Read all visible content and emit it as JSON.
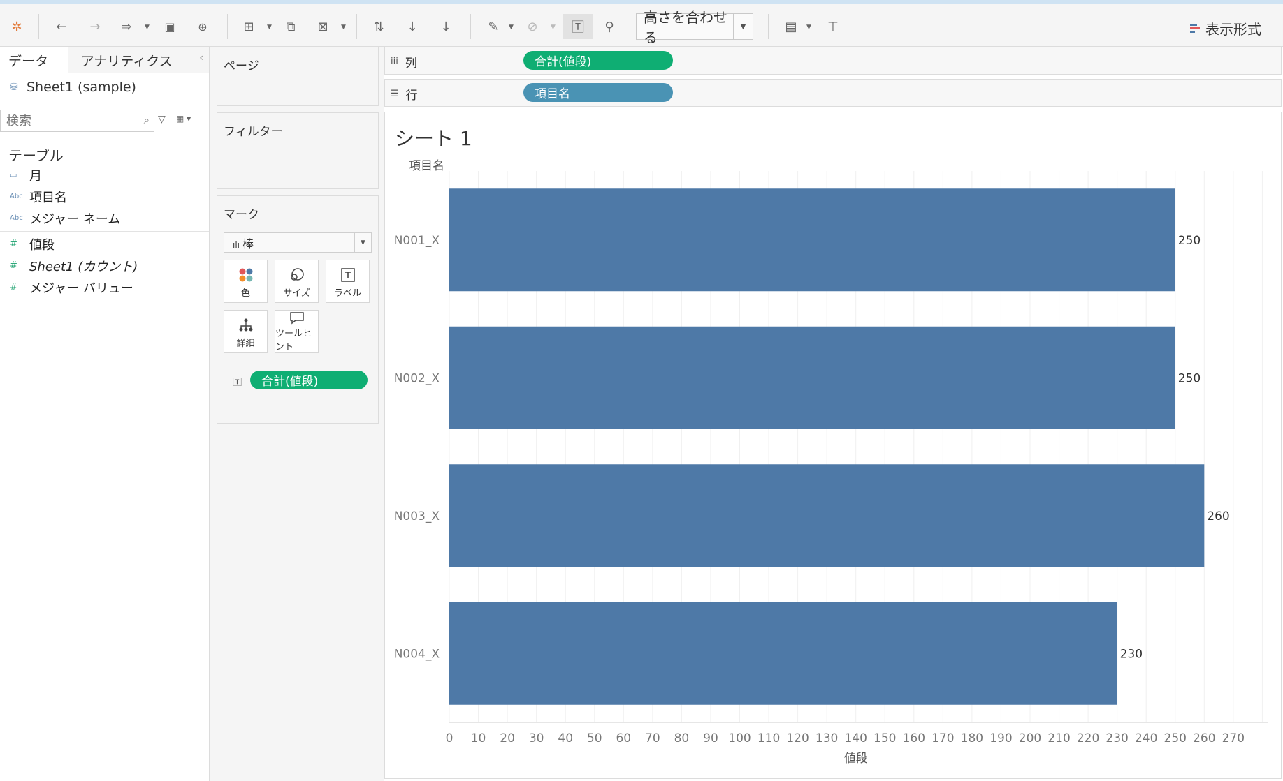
{
  "toolbar": {
    "fit_select_label": "高さを合わせる",
    "show_me_label": "表示形式"
  },
  "left_pane": {
    "tabs": [
      "データ",
      "アナリティクス"
    ],
    "datasource": "Sheet1 (sample)",
    "search_placeholder": "検索",
    "section_title": "テーブル",
    "dimensions": [
      {
        "icon": "calendar-icon",
        "label": "月"
      },
      {
        "icon": "abc-icon",
        "label": "項目名"
      },
      {
        "icon": "abc-icon",
        "label": "メジャー ネーム"
      }
    ],
    "measures": [
      {
        "icon": "hash-icon",
        "label": "値段"
      },
      {
        "icon": "hash-icon",
        "label": "Sheet1 (カウント)"
      },
      {
        "icon": "hash-icon",
        "label": "メジャー バリュー"
      }
    ]
  },
  "cards": {
    "pages_title": "ページ",
    "filters_title": "フィルター",
    "marks_title": "マーク",
    "mark_type": "棒",
    "buttons": [
      "色",
      "サイズ",
      "ラベル",
      "詳細",
      "ツールヒント"
    ],
    "label_pill": "合計(値段)"
  },
  "shelves": {
    "columns_label": "列",
    "columns_pill": "合計(値段)",
    "rows_label": "行",
    "rows_pill": "項目名"
  },
  "view": {
    "title": "シート 1",
    "row_header": "項目名"
  },
  "chart_data": {
    "type": "bar",
    "orientation": "horizontal",
    "categories": [
      "N001_X",
      "N002_X",
      "N003_X",
      "N004_X"
    ],
    "values": [
      250,
      250,
      260,
      230
    ],
    "xlabel": "値段",
    "ylabel": "項目名",
    "xlim": [
      0,
      280
    ],
    "xticks": [
      0,
      10,
      20,
      30,
      40,
      50,
      60,
      70,
      80,
      90,
      100,
      110,
      120,
      130,
      140,
      150,
      160,
      170,
      180,
      190,
      200,
      210,
      220,
      230,
      240,
      250,
      260,
      270
    ],
    "bar_color": "#4e79a7",
    "data_labels": true,
    "grid": "vertical"
  }
}
